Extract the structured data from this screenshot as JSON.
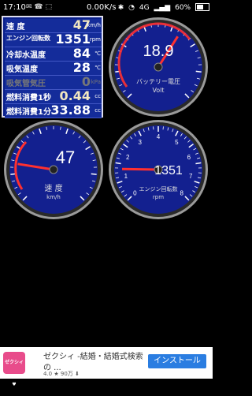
{
  "statusbar": {
    "time": "17:10",
    "speed": "0.00K/s",
    "network": "4G",
    "battery": "60%"
  },
  "panel": {
    "rows": [
      {
        "label": "速 度",
        "value": "47",
        "unit": "km/h"
      },
      {
        "label": "エンジン回転数",
        "value": "1351",
        "unit": "rpm"
      },
      {
        "label": "冷却水温度",
        "value": "84",
        "unit": "℃"
      },
      {
        "label": "吸気温度",
        "value": "28",
        "unit": "℃"
      },
      {
        "label": "吸気管気圧",
        "value": "0",
        "unit": "kPa"
      },
      {
        "label": "燃料消費1秒",
        "value": "0.44",
        "unit": "cc"
      },
      {
        "label": "燃料消費1分",
        "value": "33.88",
        "unit": "cc"
      }
    ]
  },
  "gauges": {
    "voltage": {
      "value": "18.9",
      "label": "バッテリー電圧",
      "unit": "Volt",
      "level": 0.62
    },
    "speed": {
      "value": "47",
      "label": "速 度",
      "unit": "km/h",
      "level": 0.2
    },
    "rpm": {
      "value": "1351",
      "label": "エンジン回転数",
      "unit": "rpm",
      "level": 0.17,
      "ticks": [
        "0",
        "1",
        "2",
        "3",
        "4",
        "5",
        "6",
        "7",
        "8"
      ]
    }
  },
  "ad": {
    "logo": "ゼクシィ♥",
    "title": "ゼクシィ -結婚・結婚式検索",
    "subtitle": "の ...",
    "rating": "4.0",
    "downloads": "90万",
    "button": "インストール"
  },
  "colors": {
    "panel_bg": "#0a1f8a",
    "gauge_face": "#13208f",
    "needle": "#ff3030",
    "ad_button": "#2a7de1"
  }
}
